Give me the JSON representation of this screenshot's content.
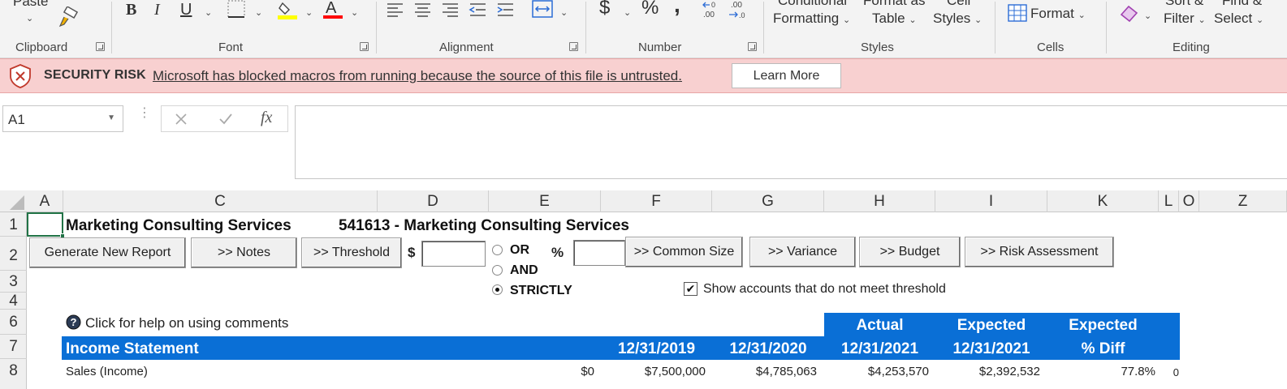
{
  "ribbon": {
    "clipboard": {
      "label": "Clipboard",
      "paste_label": "Paste"
    },
    "font": {
      "label": "Font",
      "bold": "B",
      "italic": "I",
      "underline": "U",
      "font_color_letter": "A",
      "highlight_color": "#ffff00",
      "font_color": "#ff0000"
    },
    "alignment": {
      "label": "Alignment"
    },
    "number": {
      "label": "Number",
      "currency": "$",
      "percent": "%",
      "comma": ","
    },
    "styles": {
      "label": "Styles",
      "conditional_formatting": [
        "Conditional",
        "Formatting"
      ],
      "format_as_table": [
        "Format as",
        "Table"
      ],
      "cell_styles": [
        "Cell",
        "Styles"
      ]
    },
    "cells": {
      "label": "Cells",
      "format_label": "Format"
    },
    "editing": {
      "label": "Editing",
      "sort_filter": [
        "Sort &",
        "Filter"
      ],
      "find_select": [
        "Find &",
        "Select"
      ]
    }
  },
  "security_bar": {
    "title": "SECURITY RISK",
    "message": "Microsoft has blocked macros from running because the source of this file is untrusted.",
    "button": "Learn More"
  },
  "formula_bar": {
    "name_box": "A1",
    "formula": ""
  },
  "grid": {
    "columns": [
      "A",
      "C",
      "D",
      "E",
      "F",
      "G",
      "H",
      "I",
      "K",
      "L",
      "O",
      "Z"
    ],
    "rows": [
      "1",
      "2",
      "3",
      "4",
      "6",
      "7",
      "8"
    ]
  },
  "sheet": {
    "company": "Marketing Consulting Services",
    "industry": "541613 - Marketing Consulting Services",
    "buttons": {
      "generate": "Generate New Report",
      "notes": ">> Notes",
      "threshold": ">> Threshold",
      "common_size": ">> Common Size",
      "variance": ">> Variance",
      "budget": ">> Budget",
      "risk": ">> Risk Assessment"
    },
    "dollar_sign": "$",
    "percent_sign": "%",
    "radio": {
      "or": "OR",
      "and": "AND",
      "strictly": "STRICTLY",
      "selected": "STRICTLY"
    },
    "checkbox_label": "Show accounts that do not meet threshold",
    "help_text": "Click for help on using comments",
    "table": {
      "title": "Income Statement",
      "headers": {
        "col1": "12/31/2019",
        "col2": "12/31/2020",
        "col3_top": "Actual",
        "col3": "12/31/2021",
        "col4_top": "Expected",
        "col4": "12/31/2021",
        "col5_top": "Expected",
        "col5": "% Diff"
      },
      "rows": [
        {
          "label": "Sales (Income)",
          "d": "$0",
          "v1": "$7,500,000",
          "v2": "$4,785,063",
          "v3": "$4,253,570",
          "v4": "$2,392,532",
          "pct": "77.8%",
          "extra": "0"
        }
      ]
    }
  }
}
